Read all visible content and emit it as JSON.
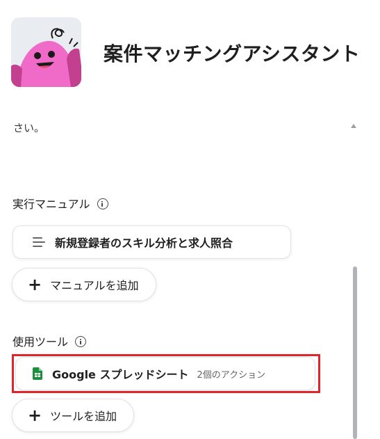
{
  "header": {
    "title": "案件マッチングアシスタント",
    "avatar_icon": "pink-mascot-avatar"
  },
  "instructions": {
    "visible_text": "さい。",
    "collapse_icon": "triangle-up-icon"
  },
  "manual_section": {
    "label": "実行マニュアル",
    "info_icon": "info-icon",
    "items": [
      {
        "label": "新規登録者のスキル分析と求人照合",
        "icon": "list-lines-icon"
      }
    ],
    "add_button_label": "マニュアルを追加"
  },
  "tools_section": {
    "label": "使用ツール",
    "info_icon": "info-icon",
    "items": [
      {
        "label": "Google スプレッドシート",
        "sublabel": "2個のアクション",
        "icon": "google-sheets-icon"
      }
    ],
    "add_button_label": "ツールを追加"
  },
  "colors": {
    "highlight": "#e0242b",
    "sheets_green": "#1e8e3e",
    "mascot_pink": "#f06ac8"
  }
}
